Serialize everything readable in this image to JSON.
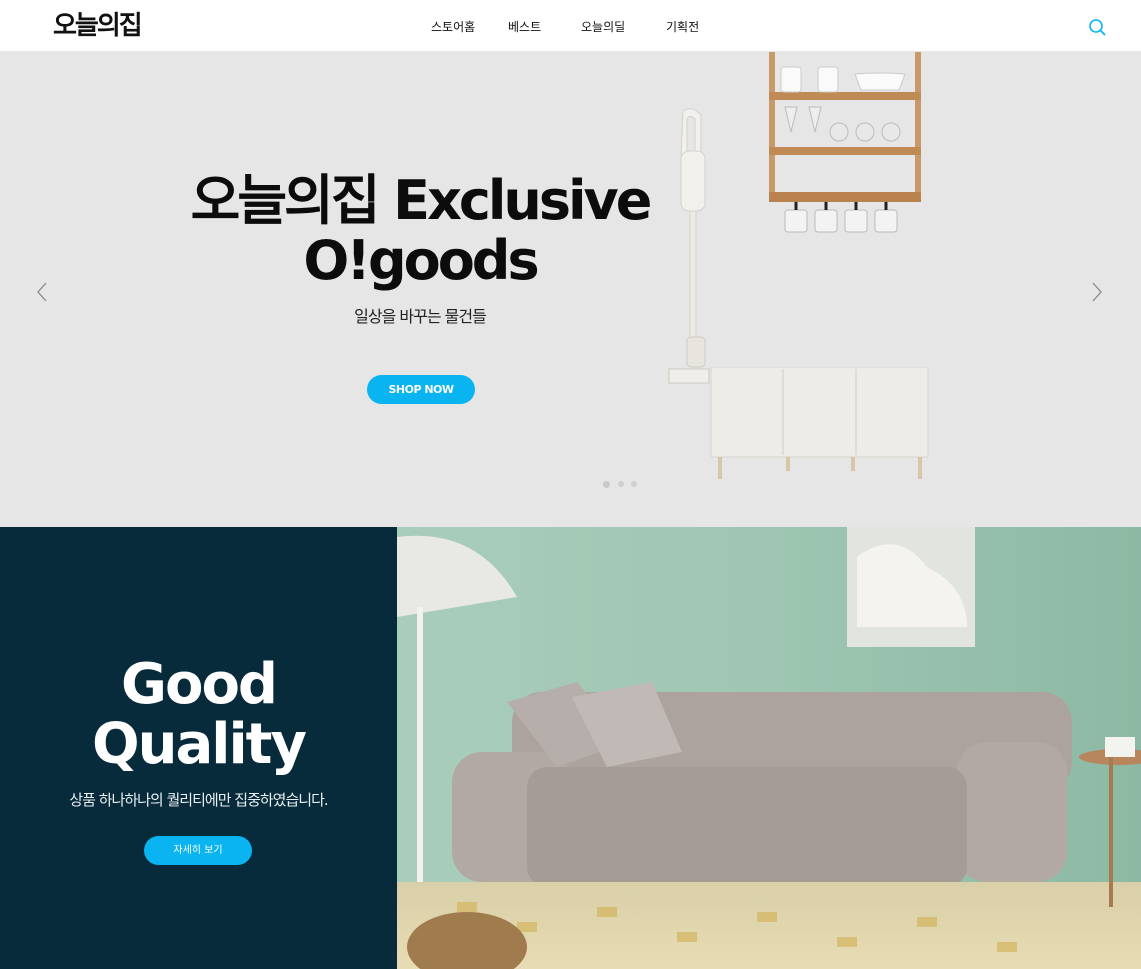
{
  "header": {
    "logo": "오늘의집",
    "nav": [
      {
        "label": "스토어홈"
      },
      {
        "label": "베스트"
      },
      {
        "label": "오늘의딜"
      },
      {
        "label": "기획전"
      }
    ]
  },
  "hero": {
    "title_line1": "오늘의집 Exclusive",
    "title_line2": "O!goods",
    "subtitle": "일상을 바꾸는 물건들",
    "cta": "SHOP NOW",
    "slide_count": 3,
    "active_slide": 1
  },
  "quality": {
    "title_line1": "Good",
    "title_line2": "Quality",
    "subtitle": "상품 하나하나의 퀄리티에만 집중하였습니다.",
    "cta": "자세히 보기"
  },
  "colors": {
    "accent": "#0ab4f0",
    "hero_bg": "#e6e6e6",
    "quality_bg": "#072b3b",
    "wall": "#9cc3b0"
  }
}
